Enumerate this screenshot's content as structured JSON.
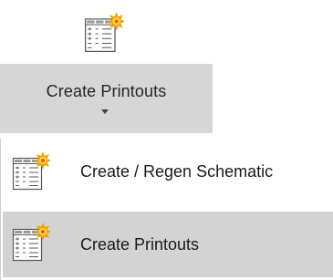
{
  "ribbon_button": {
    "label": "Create Printouts",
    "icon": "printouts-table-icon",
    "dropdown_icon": "dropdown-arrow-icon"
  },
  "menu": {
    "items": [
      {
        "label": "Create / Regen Schematic",
        "icon": "schematic-table-icon",
        "highlighted": false
      },
      {
        "label": "Create Printouts",
        "icon": "printouts-table-icon",
        "highlighted": true
      }
    ]
  },
  "colors": {
    "ribbon_bottom_bg": "#d6d6d6",
    "highlight_bg": "#d3d3d3",
    "icon_border": "#5a5a5a",
    "icon_header": "#9a9a9a",
    "burst_outer": "#f2a000",
    "burst_inner": "#ffe14d"
  }
}
